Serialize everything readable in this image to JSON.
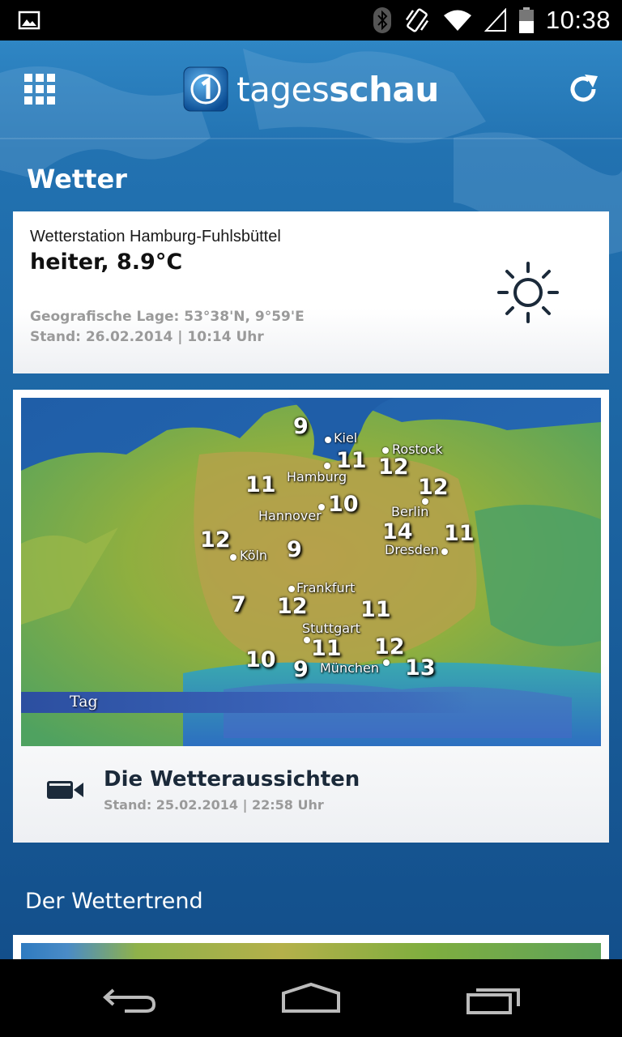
{
  "status": {
    "time": "10:38"
  },
  "header": {
    "logo_light": "tages",
    "logo_bold": "schau"
  },
  "section": {
    "title": "Wetter"
  },
  "station": {
    "name": "Wetterstation Hamburg-Fuhlsbüttel",
    "condition": "heiter, 8.9°C",
    "geo": "Geografische Lage: 53°38'N, 9°59'E",
    "stand": "Stand: 26.02.2014 | 10:14  Uhr",
    "icon": "sun-icon"
  },
  "map": {
    "tag": "Tag",
    "cities": [
      {
        "name": "Kiel"
      },
      {
        "name": "Rostock"
      },
      {
        "name": "Hamburg"
      },
      {
        "name": "Hannover"
      },
      {
        "name": "Berlin"
      },
      {
        "name": "Köln"
      },
      {
        "name": "Dresden"
      },
      {
        "name": "Frankfurt"
      },
      {
        "name": "Stuttgart"
      },
      {
        "name": "München"
      }
    ],
    "temps": [
      "9",
      "11",
      "12",
      "11",
      "12",
      "10",
      "12",
      "14",
      "11",
      "9",
      "7",
      "12",
      "11",
      "11",
      "12",
      "10",
      "9",
      "13"
    ]
  },
  "video": {
    "title": "Die Wetteraussichten",
    "stand": "Stand: 25.02.2014 | 22:58 Uhr",
    "icon": "video-camera-icon"
  },
  "trend": {
    "title": "Der Wettertrend"
  },
  "colors": {
    "brand": "#1d67a5",
    "text_dark": "#1b2a3a",
    "meta_gray": "#9a9a9a"
  }
}
